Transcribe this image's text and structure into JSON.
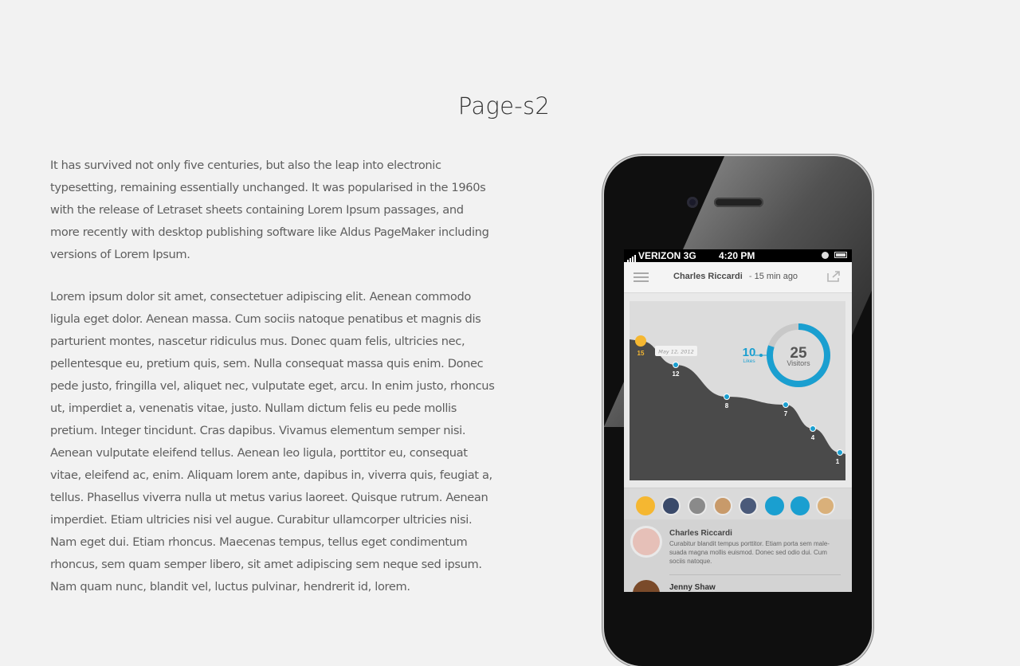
{
  "page": {
    "title": "Page-s2",
    "paragraphs": [
      "It has survived not only five centuries, but also the leap into electronic typesetting, remaining essentially unchanged. It was popularised in the 1960s with the release of Letraset sheets containing Lorem Ipsum passages, and more recently with desktop publishing software like Aldus PageMaker including versions of Lorem Ipsum.",
      "Lorem ipsum dolor sit amet, consectetuer adipiscing elit. Aenean commodo ligula eget dolor. Aenean massa. Cum sociis natoque penatibus et magnis dis parturient montes, nascetur ridiculus mus. Donec quam felis, ultricies nec, pellentesque eu, pretium quis, sem. Nulla consequat massa quis enim. Donec pede justo, fringilla vel, aliquet nec, vulputate eget, arcu. In enim justo, rhoncus ut, imperdiet a, venenatis vitae, justo. Nullam dictum felis eu pede mollis pretium. Integer tincidunt. Cras dapibus. Vivamus elementum semper nisi. Aenean vulputate eleifend tellus. Aenean leo ligula, porttitor eu, consequat vitae, eleifend ac, enim. Aliquam lorem ante, dapibus in, viverra quis, feugiat a, tellus. Phasellus viverra nulla ut metus varius laoreet. Quisque rutrum. Aenean imperdiet. Etiam ultricies nisi vel augue. Curabitur ullamcorper ultricies nisi. Nam eget dui. Etiam rhoncus. Maecenas tempus, tellus eget condimentum rhoncus, sem quam semper libero, sit amet adipiscing sem neque sed ipsum. Nam quam nunc, blandit vel, luctus pulvinar, hendrerit id, lorem."
    ]
  },
  "phone": {
    "status": {
      "carrier": "VERIZON 3G",
      "time": "4:20 PM"
    },
    "appbar": {
      "user": "Charles Riccardi",
      "separator": "-",
      "ago": "15 min ago"
    },
    "stats": {
      "likes_value": "10",
      "likes_label": "Likes",
      "visitors_value": "25",
      "visitors_label": "Visitors",
      "visitors_progress": 0.8
    },
    "date_tag": "May 12, 2012",
    "colors": {
      "accent": "#1a9fd0",
      "highlight": "#f5b731",
      "area": "#4a4a4a"
    },
    "avatars": [
      "avatar-orange",
      "avatar-man",
      "avatar-gray",
      "avatar-woman",
      "avatar-man2",
      "avatar-blue",
      "avatar-blue2",
      "avatar-woman2"
    ],
    "comments": [
      {
        "name": "Charles Riccardi",
        "text": "Curabitur blandit tempus porttitor. Etiam porta sem male-suada magna mollis euismod. Donec sed odio dui. Cum sociis natoque."
      },
      {
        "name": "Jenny Shaw"
      }
    ]
  },
  "chart_data": {
    "type": "area",
    "x": [
      1,
      2,
      3,
      4,
      5,
      6
    ],
    "values": [
      15,
      12,
      8,
      7,
      4,
      1
    ],
    "labels": [
      "15",
      "12",
      "8",
      "7",
      "4",
      "1"
    ],
    "highlighted_point": 0
  }
}
